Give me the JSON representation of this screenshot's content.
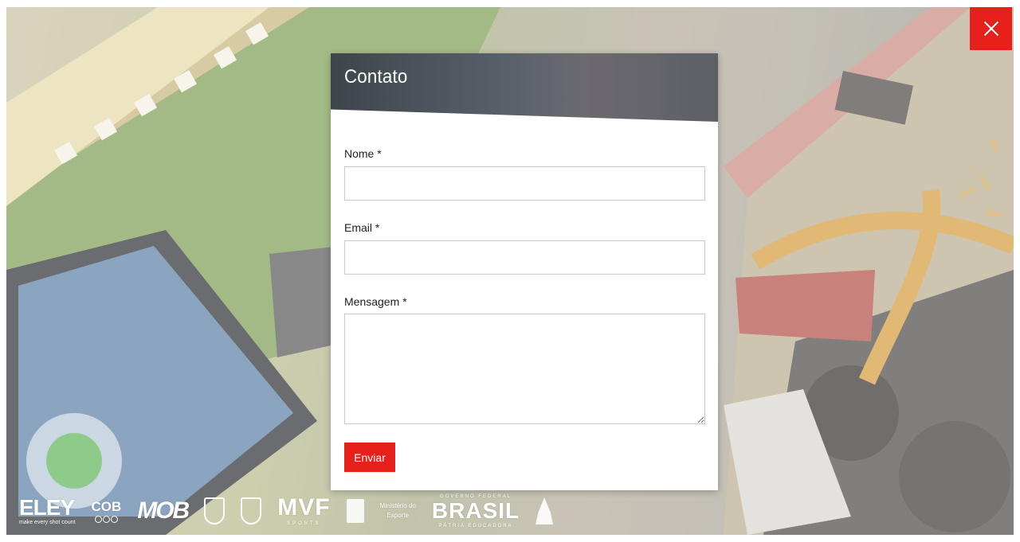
{
  "modal": {
    "title": "Contato",
    "fields": [
      {
        "label": "Nome",
        "required_mark": "*",
        "value": "",
        "placeholder": ""
      },
      {
        "label": "Email",
        "required_mark": "*",
        "value": "",
        "placeholder": ""
      },
      {
        "label": "Mensagem",
        "required_mark": "*",
        "value": "",
        "placeholder": ""
      }
    ],
    "submit_label": "Enviar"
  },
  "close_icon": "close-icon",
  "colors": {
    "accent": "#e8201b",
    "header_dark": "#3e454c",
    "field_border": "#c9c9c9"
  },
  "sponsors": {
    "eley": {
      "name": "ELEY",
      "tagline": "make every shot count"
    },
    "cob": {
      "name": "COB"
    },
    "mob": {
      "name": "MOB"
    },
    "mvf": {
      "name": "MVF",
      "tagline": "SPORTS"
    },
    "ministerio": {
      "line1": "Ministério do",
      "line2": "Esporte"
    },
    "brasil": {
      "top": "GOVERNO FEDERAL",
      "name": "BRASIL",
      "bottom": "PÁTRIA EDUCADORA"
    }
  }
}
